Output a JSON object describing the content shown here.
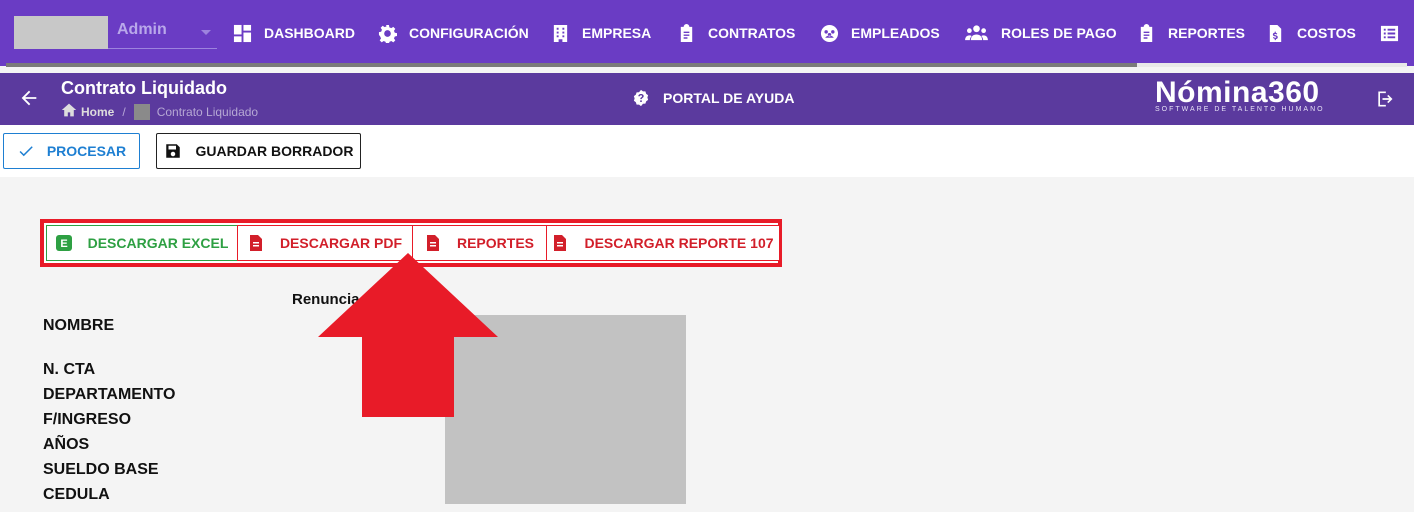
{
  "topnav": {
    "user": {
      "name": "Admin"
    },
    "items": [
      {
        "label": "DASHBOARD",
        "icon": "dashboard-icon"
      },
      {
        "label": "CONFIGURACIÓN",
        "icon": "gear-icon"
      },
      {
        "label": "EMPRESA",
        "icon": "building-icon"
      },
      {
        "label": "CONTRATOS",
        "icon": "clipboard-icon"
      },
      {
        "label": "EMPLEADOS",
        "icon": "employees-icon"
      },
      {
        "label": "ROLES DE PAGO",
        "icon": "users-icon"
      },
      {
        "label": "REPORTES",
        "icon": "clipboard-icon"
      },
      {
        "label": "COSTOS",
        "icon": "invoice-dollar-icon"
      },
      {
        "label": "",
        "icon": "list-icon"
      }
    ]
  },
  "header": {
    "title": "Contrato Liquidado",
    "breadcrumb": {
      "home": "Home",
      "separator": "/",
      "current": "Contrato Liquidado"
    },
    "help": "PORTAL DE AYUDA",
    "logo": {
      "main": "Nómina360",
      "tagline": "SOFTWARE DE TALENTO HUMANO"
    }
  },
  "toolbar": {
    "procesar": "PROCESAR",
    "guardar": "GUARDAR BORRADOR"
  },
  "downloads": {
    "excel": "DESCARGAR EXCEL",
    "excel_badge": "E",
    "pdf": "DESCARGAR PDF",
    "reportes": "REPORTES",
    "reporte107": "DESCARGAR REPORTE 107"
  },
  "contract": {
    "type": "Renuncia",
    "fields": [
      "NOMBRE",
      "N. CTA",
      "DEPARTAMENTO",
      "F/INGRESO",
      "AÑOS",
      "SUELDO BASE",
      "CEDULA"
    ]
  },
  "colors": {
    "nav_bg": "#6a3cc4",
    "subheader_bg": "#5b3a9e",
    "highlight_red": "#e81b28",
    "excel_green": "#2ea043",
    "primary_blue": "#1e7fd2"
  }
}
